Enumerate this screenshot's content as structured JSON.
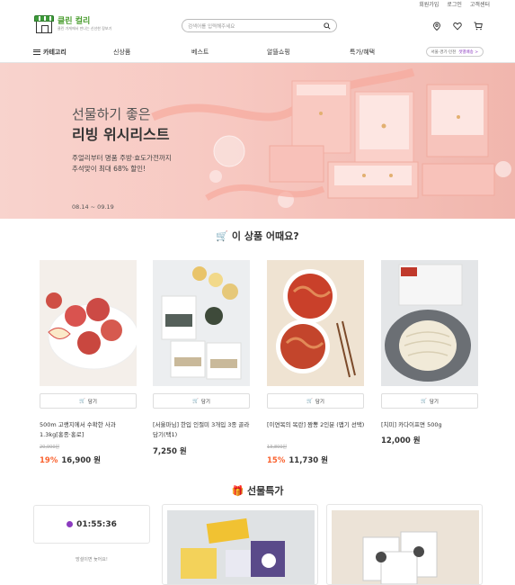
{
  "top_links": [
    "회원가입",
    "로그인",
    "고객센터"
  ],
  "logo": {
    "name": "클린 컬리",
    "sub": "클린 가게에서 만나는 신선한 장보기"
  },
  "search": {
    "placeholder": "검색어를 입력해주세요"
  },
  "nav": {
    "category": "카테고리",
    "items": [
      "신상품",
      "베스트",
      "알뜰쇼핑",
      "특가/혜택"
    ],
    "delivery_prefix": "서울·경기·인천",
    "delivery_highlight": "샛별배송 >"
  },
  "banner": {
    "title1": "선물하기 좋은",
    "title2": "리빙 위시리스트",
    "desc1": "주얼리부터 명품 주방·효도가전까지",
    "desc2": "추석맞이 최대 68% 할인!",
    "date": "08.14 ~ 09.19"
  },
  "recommend": {
    "title": "이 상품 어때요?",
    "cart_label": "담기",
    "products": [
      {
        "name": "500m 고랭지에서 수확한 사과 1.3kg[홍종·홍로]",
        "original": "20,900원",
        "discount": "19%",
        "price": "16,900 원"
      },
      {
        "name": "[서울마님] 한입 인절미 3개입 3종 골라담기(택1)",
        "original": "",
        "discount": "",
        "price": "7,250 원"
      },
      {
        "name": "[이연복의 목란] 짬뽕 2인분 (맵기 선택)",
        "original": "13,800원",
        "discount": "15%",
        "price": "11,730 원"
      },
      {
        "name": "[치미] 카다이프면 500g",
        "original": "",
        "discount": "",
        "price": "12,000 원"
      }
    ]
  },
  "gift": {
    "title": "선물특가",
    "timer": "01:55:36",
    "note": "망설이면 늦어요!"
  },
  "colors": {
    "accent": "#8b3bbf",
    "discount": "#fa622f",
    "logo_green": "#4a9d2e"
  }
}
